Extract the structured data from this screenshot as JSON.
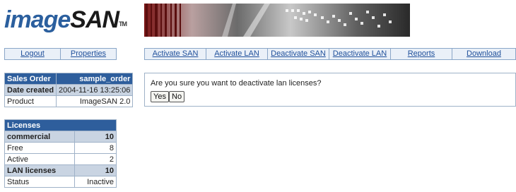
{
  "logo": {
    "part1": "image",
    "part2": "SAN",
    "tm": "TM"
  },
  "left_nav": [
    {
      "label": "Logout"
    },
    {
      "label": "Properties"
    }
  ],
  "top_nav": [
    {
      "label": "Activate SAN"
    },
    {
      "label": "Activate LAN"
    },
    {
      "label": "Deactivate SAN"
    },
    {
      "label": "Deactivate LAN"
    },
    {
      "label": "Reports"
    },
    {
      "label": "Download"
    }
  ],
  "order": {
    "header_label": "Sales Order",
    "header_value": "sample_order",
    "rows": [
      {
        "label": "Date created",
        "value": "2004-11-16 13:25:06"
      },
      {
        "label": "Product",
        "value": "ImageSAN 2.0"
      }
    ]
  },
  "licenses": {
    "header_label": "Licenses",
    "rows": [
      {
        "label": "commercial",
        "value": "10"
      },
      {
        "label": "Free",
        "value": "8"
      },
      {
        "label": "Active",
        "value": "2"
      },
      {
        "label": "LAN licenses",
        "value": "10"
      },
      {
        "label": "Status",
        "value": "Inactive"
      }
    ]
  },
  "dialog": {
    "message": "Are you sure you want to deactivate lan licenses?",
    "yes_label": "Yes",
    "no_label": "No"
  },
  "colors": {
    "accent": "#2e5e9c",
    "band": "#c9d4e2",
    "link": "#1f4f9a"
  }
}
